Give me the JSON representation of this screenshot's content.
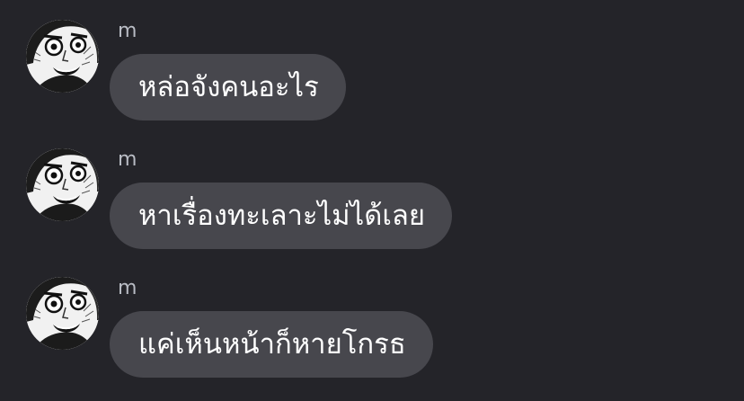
{
  "messages": [
    {
      "sender": "m",
      "text": "หล่อจังคนอะไร",
      "avatar_icon": "manga-face-avatar-icon"
    },
    {
      "sender": "m",
      "text": "หาเรื่องทะเลาะไม่ได้เลย",
      "avatar_icon": "manga-face-avatar-icon"
    },
    {
      "sender": "m",
      "text": "แค่เห็นหน้าก็หายโกรธ",
      "avatar_icon": "manga-face-avatar-icon"
    }
  ],
  "colors": {
    "background": "#242429",
    "bubble": "#47474d",
    "sender_text": "#b9bcc4",
    "message_text": "#ffffff"
  }
}
